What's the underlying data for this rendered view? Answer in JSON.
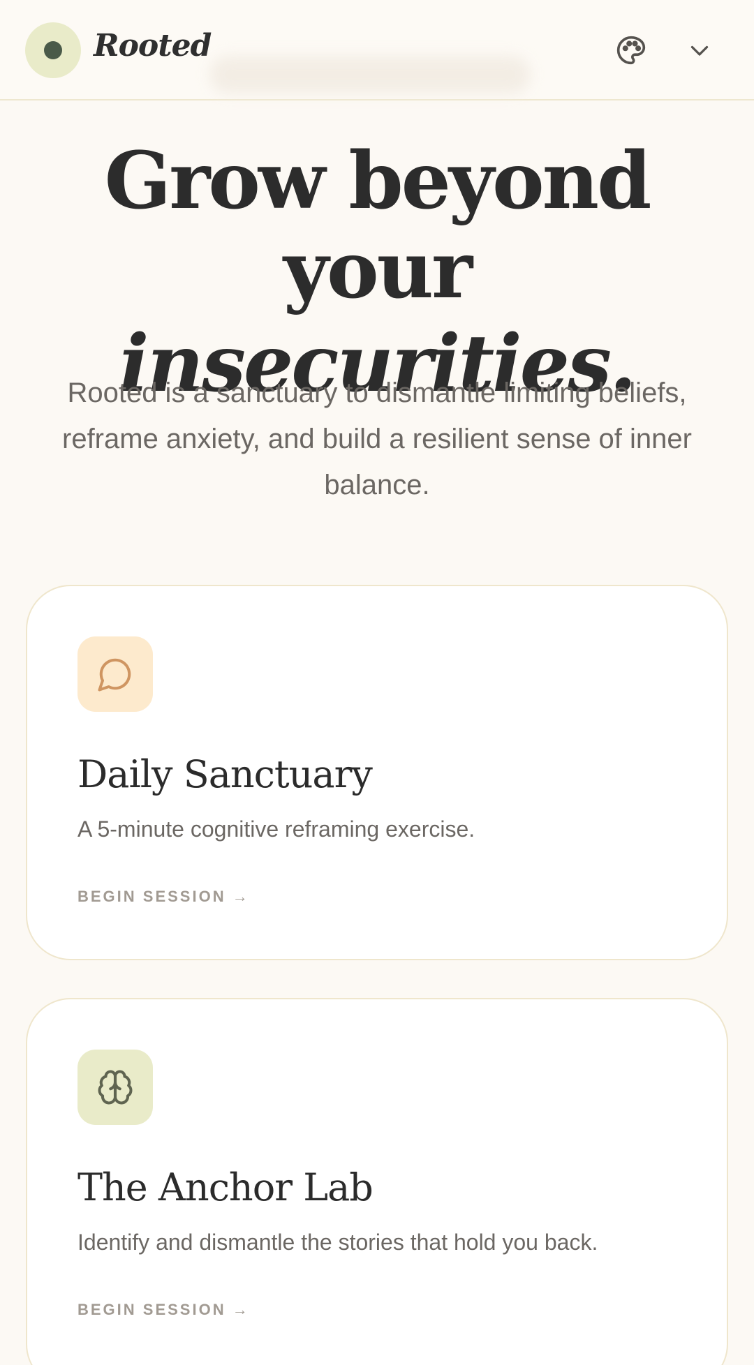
{
  "header": {
    "brand": "Rooted",
    "logo_icon": "circle-dot-logo-icon",
    "palette_icon": "palette-icon",
    "menu_icon": "chevron-down-icon"
  },
  "hero": {
    "title_line1": "Grow beyond your",
    "title_line2": "insecurities.",
    "subtitle": "Rooted is a sanctuary to dismantle limiting beliefs, reframe anxiety, and build a resilient sense of inner balance."
  },
  "cards": [
    {
      "icon": "message-circle-icon",
      "icon_color": "#cf9561",
      "icon_bg": "#fdeacd",
      "title": "Daily Sanctuary",
      "description": "A 5-minute cognitive reframing exercise.",
      "link": "BEGIN SESSION →"
    },
    {
      "icon": "brain-icon",
      "icon_color": "#5f6450",
      "icon_bg": "#e9ebc9",
      "title": "The Anchor Lab",
      "description": "Identify and dismantle the stories that hold you back.",
      "link": "BEGIN SESSION →"
    }
  ],
  "colors": {
    "background": "#fcf9f4",
    "text": "#2b2b2b",
    "muted": "#6b6763",
    "accent_green": "#4a5a49",
    "card_border": "#efe6cc"
  }
}
